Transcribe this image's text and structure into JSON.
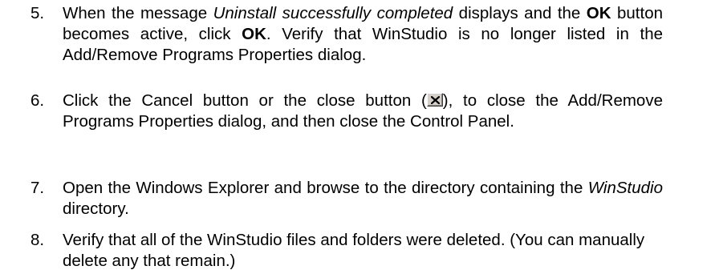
{
  "steps": [
    {
      "number": "5.",
      "segments": [
        {
          "text": "When the message ",
          "style": "normal"
        },
        {
          "text": "Uninstall successfully completed",
          "style": "italic"
        },
        {
          "text": " displays and the ",
          "style": "normal"
        },
        {
          "text": "OK",
          "style": "bold"
        },
        {
          "text": " button becomes active, click ",
          "style": "normal"
        },
        {
          "text": "OK",
          "style": "bold"
        },
        {
          "text": ". Verify that WinStudio is no longer listed in the Add/Remove Programs Properties dialog.",
          "style": "normal"
        }
      ]
    },
    {
      "number": "6.",
      "before_icon": "Click the Cancel button or the close button (",
      "icon": "close-x-icon",
      "after_icon": "), to close the Add/Remove Programs Properties dialog, and then close the Control Panel."
    },
    {
      "number": "7.",
      "segments": [
        {
          "text": "Open the Windows Explorer and browse to the directory containing the ",
          "style": "normal"
        },
        {
          "text": "WinStudio",
          "style": "italic"
        },
        {
          "text": " directory.",
          "style": "normal"
        }
      ]
    },
    {
      "number": "8.",
      "text": "Verify that all of the WinStudio files and folders were deleted. (You can manually delete any that remain.)"
    }
  ]
}
